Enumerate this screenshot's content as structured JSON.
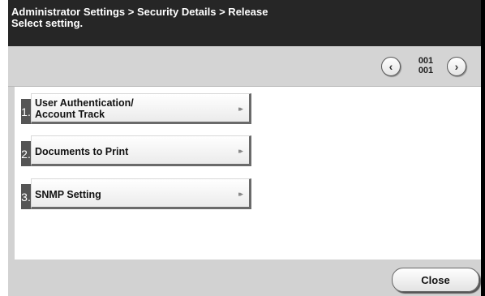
{
  "header": {
    "title": "Administrator Settings > Security Details > Release",
    "subtitle": "Select setting."
  },
  "pager": {
    "prev_icon": "chevron-left-icon",
    "next_icon": "chevron-right-icon",
    "current": "001",
    "total": "001"
  },
  "menu": {
    "items": [
      {
        "number": "1.",
        "label_line1": "User Authentication/",
        "label_line2": "Account Track"
      },
      {
        "number": "2.",
        "label": "Documents to Print"
      },
      {
        "number": "3.",
        "label": "SNMP Setting"
      }
    ],
    "arrow_icon": "double-chevron-right-icon",
    "arrow_glyph": "▸▸"
  },
  "footer": {
    "close_label": "Close"
  }
}
